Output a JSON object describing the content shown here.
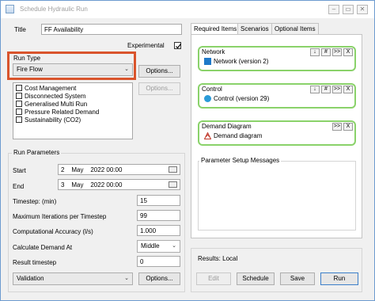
{
  "window": {
    "title": "Schedule Hydraulic Run"
  },
  "left": {
    "title_label": "Title",
    "title_value": "FF Availability",
    "experimental_label": "Experimental",
    "experimental_checked": true,
    "run_type_label": "Run Type",
    "run_type_value": "Fire Flow",
    "options_label": "Options...",
    "options2_label": "Options...",
    "run_options": [
      "Cost Management",
      "Disconnected System",
      "Generalised Multi Run",
      "Pressure Related Demand",
      "Sustainability (CO2)"
    ],
    "run_params_label": "Run Parameters",
    "start_label": "Start",
    "start_day": "2",
    "start_month": "May",
    "start_rest": "2022  00:00",
    "end_label": "End",
    "end_day": "3",
    "end_month": "May",
    "end_rest": "2022  00:00",
    "timestep_label": "Timestep: (min)",
    "timestep_value": "15",
    "max_iter_label": "Maximum Iterations per Timestep",
    "max_iter_value": "99",
    "accuracy_label": "Computational Accuracy (l/s)",
    "accuracy_value": "1.000",
    "calc_demand_label": "Calculate Demand At",
    "calc_demand_value": "Middle",
    "result_ts_label": "Result timestep",
    "result_ts_value": "0",
    "validation_value": "Validation",
    "validation_options_label": "Options..."
  },
  "right": {
    "tabs": [
      "Required Items",
      "Scenarios",
      "Optional Items"
    ],
    "network": {
      "header": "Network",
      "item": "Network (version 2)"
    },
    "control": {
      "header": "Control",
      "item": "Control (version 29)"
    },
    "demand": {
      "header": "Demand Diagram",
      "item": "Demand diagram"
    },
    "mini_buttons": {
      "down": "↓",
      "hash": "#",
      "fwd": ">>",
      "x": "X"
    },
    "setup_messages_label": "Parameter Setup Messages",
    "results_label": "Results: Local",
    "buttons": {
      "edit": "Edit",
      "schedule": "Schedule",
      "save": "Save",
      "run": "Run"
    }
  },
  "colors": {
    "highlight": "#d9542c",
    "required_border": "#8ad26a",
    "window_border": "#6d9bcf"
  }
}
